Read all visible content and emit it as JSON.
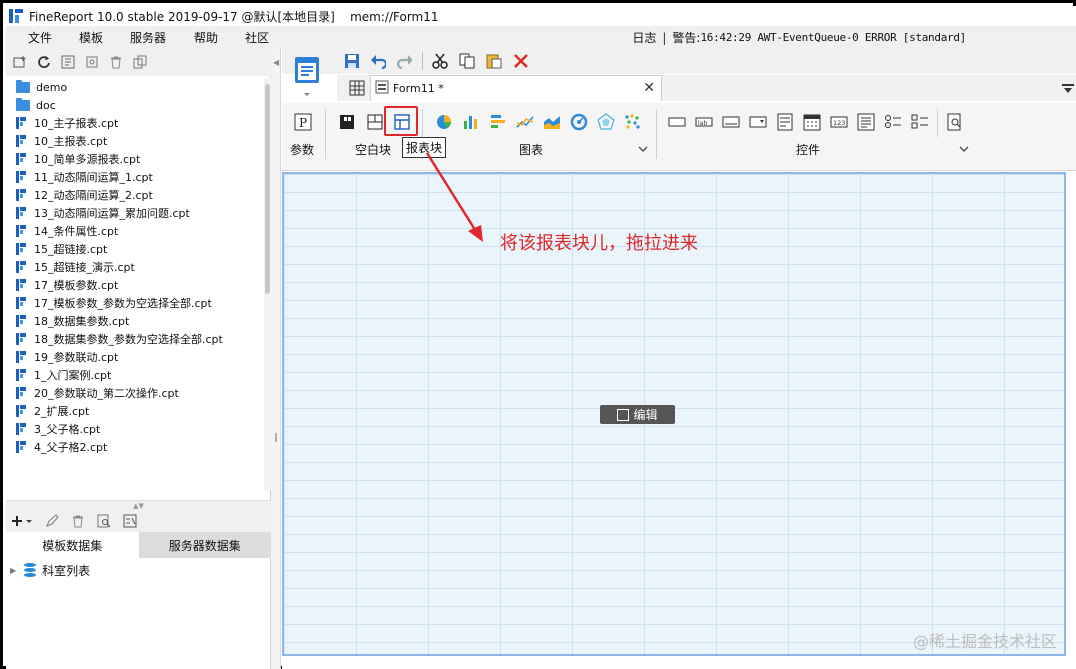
{
  "window": {
    "title": "FineReport 10.0 stable 2019-09-17 @默认[本地目录]    mem://Form11"
  },
  "menu": {
    "items": [
      "文件",
      "模板",
      "服务器",
      "帮助",
      "社区"
    ],
    "log_label": "日志",
    "warning_label": "警告:",
    "warning_detail": "16:42:29 AWT-EventQueue-0 ERROR [standard]"
  },
  "file_tree": {
    "folders": [
      "demo",
      "doc"
    ],
    "files": [
      "10_主子报表.cpt",
      "10_主报表.cpt",
      "10_简单多源报表.cpt",
      "11_动态隔间运算_1.cpt",
      "12_动态隔间运算_2.cpt",
      "13_动态隔间运算_累加问题.cpt",
      "14_条件属性.cpt",
      "15_超链接.cpt",
      "15_超链接_演示.cpt",
      "17_模板参数.cpt",
      "17_模板参数_参数为空选择全部.cpt",
      "18_数据集参数.cpt",
      "18_数据集参数_参数为空选择全部.cpt",
      "19_参数联动.cpt",
      "1_入门案例.cpt",
      "20_参数联动_第二次操作.cpt",
      "2_扩展.cpt",
      "3_父子格.cpt",
      "4_父子格2.cpt"
    ]
  },
  "dataset": {
    "tabs": [
      "模板数据集",
      "服务器数据集"
    ],
    "tree_item": "科室列表"
  },
  "editor": {
    "tab_label": "Form11 *",
    "groups": {
      "param": "参数",
      "blank": "空白块",
      "chart": "图表",
      "widget": "控件"
    },
    "tooltip": "报表块",
    "edit_button": "编辑"
  },
  "annotation": {
    "text": "将该报表块儿，拖拉进来",
    "color": "#e0262a"
  },
  "watermark": "@稀土掘金技术社区"
}
